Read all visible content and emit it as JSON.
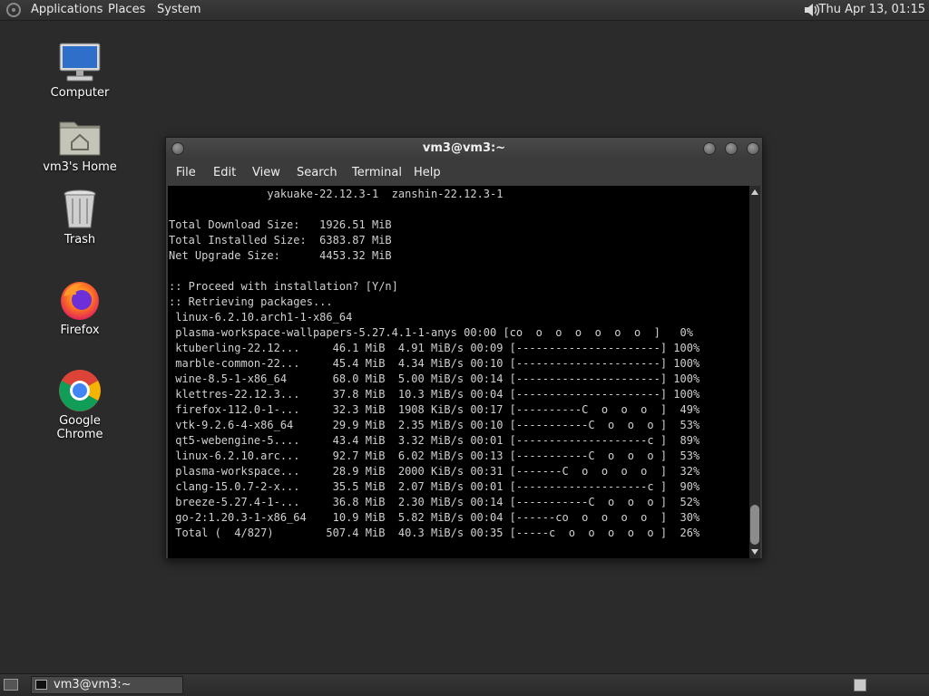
{
  "top_panel": {
    "menus": [
      "Applications",
      "Places",
      "System"
    ],
    "clock": "Thu Apr 13, 01:15"
  },
  "desktop_icons": [
    {
      "label": "Computer"
    },
    {
      "label": "vm3's Home"
    },
    {
      "label": "Trash"
    },
    {
      "label": "Firefox"
    },
    {
      "label": "Google Chrome"
    }
  ],
  "terminal": {
    "title": "vm3@vm3:~",
    "menus": [
      "File",
      "Edit",
      "View",
      "Search",
      "Terminal",
      "Help"
    ],
    "lines": [
      "               yakuake-22.12.3-1  zanshin-22.12.3-1",
      "",
      "Total Download Size:   1926.51 MiB",
      "Total Installed Size:  6383.87 MiB",
      "Net Upgrade Size:      4453.32 MiB",
      "",
      ":: Proceed with installation? [Y/n]",
      ":: Retrieving packages...",
      " linux-6.2.10.arch1-1-x86_64",
      " plasma-workspace-wallpapers-5.27.4.1-1-anys 00:00 [co  o  o  o  o  o  o  ]   0%",
      " ktuberling-22.12...     46.1 MiB  4.91 MiB/s 00:09 [----------------------] 100%",
      " marble-common-22...     45.4 MiB  4.34 MiB/s 00:10 [----------------------] 100%",
      " wine-8.5-1-x86_64       68.0 MiB  5.00 MiB/s 00:14 [----------------------] 100%",
      " klettres-22.12.3...     37.8 MiB  10.3 MiB/s 00:04 [----------------------] 100%",
      " firefox-112.0-1-...     32.3 MiB  1908 KiB/s 00:17 [----------C  o  o  o  ]  49%",
      " vtk-9.2.6-4-x86_64      29.9 MiB  2.35 MiB/s 00:10 [-----------C  o  o  o ]  53%",
      " qt5-webengine-5....     43.4 MiB  3.32 MiB/s 00:01 [--------------------c ]  89%",
      " linux-6.2.10.arc...     92.7 MiB  6.02 MiB/s 00:13 [-----------C  o  o  o ]  53%",
      " plasma-workspace...     28.9 MiB  2000 KiB/s 00:31 [-------C  o  o  o  o  ]  32%",
      " clang-15.0.7-2-x...     35.5 MiB  2.07 MiB/s 00:01 [--------------------c ]  90%",
      " breeze-5.27.4-1-...     36.8 MiB  2.30 MiB/s 00:14 [-----------C  o  o  o ]  52%",
      " go-2:1.20.3-1-x86_64    10.9 MiB  5.82 MiB/s 00:04 [------co  o  o  o  o  ]  30%",
      " Total (  4/827)        507.4 MiB  40.3 MiB/s 00:35 [-----c  o  o  o  o  o ]  26%"
    ]
  },
  "taskbar": {
    "task_label": "vm3@vm3:~"
  },
  "colors": {
    "panel": "#2e2e2e",
    "desktop": "#2b2b2b",
    "terminal_bg": "#000000",
    "terminal_fg": "#d0d0d0",
    "pacman": "#e8e070"
  }
}
